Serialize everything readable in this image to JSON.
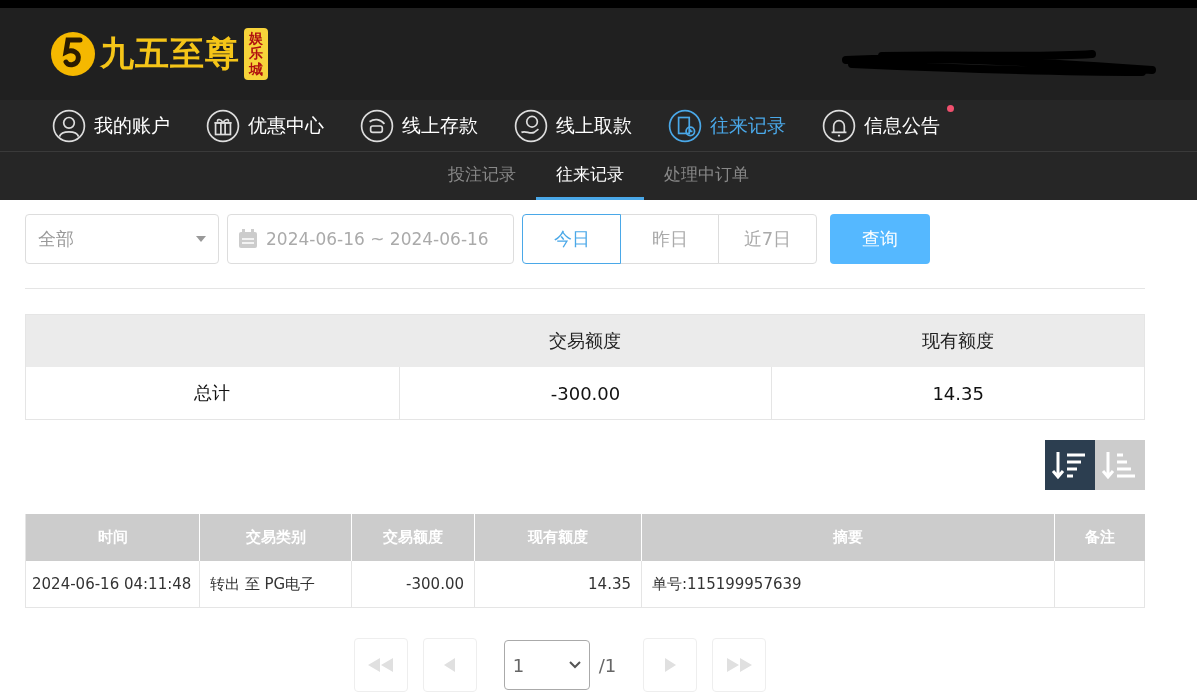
{
  "brand": {
    "name": "九五至尊",
    "badge": "娱乐城"
  },
  "nav": [
    {
      "kind": "account",
      "label": "我的账户",
      "selected": false,
      "dot": false
    },
    {
      "kind": "gift",
      "label": "优惠中心",
      "selected": false,
      "dot": false
    },
    {
      "kind": "deposit",
      "label": "线上存款",
      "selected": false,
      "dot": false
    },
    {
      "kind": "withdraw",
      "label": "线上取款",
      "selected": false,
      "dot": false
    },
    {
      "kind": "records",
      "label": "往来记录",
      "selected": true,
      "dot": false
    },
    {
      "kind": "bell",
      "label": "信息公告",
      "selected": false,
      "dot": true
    }
  ],
  "subtabs": [
    {
      "label": "投注记录",
      "selected": false
    },
    {
      "label": "往来记录",
      "selected": true
    },
    {
      "label": "处理中订单",
      "selected": false
    }
  ],
  "filters": {
    "type_select": {
      "value": "全部"
    },
    "date_range": {
      "value": "2024-06-16 ~ 2024-06-16"
    },
    "quick_ranges": [
      {
        "label": "今日",
        "selected": true
      },
      {
        "label": "昨日",
        "selected": false
      },
      {
        "label": "近7日",
        "selected": false
      }
    ],
    "search_button": "查询"
  },
  "summary": {
    "columns": [
      "交易额度",
      "现有额度"
    ],
    "row": {
      "label": "总计",
      "values": [
        "-300.00",
        "14.35"
      ]
    }
  },
  "sort_buttons": [
    {
      "kind": "desc",
      "selected": true
    },
    {
      "kind": "asc",
      "selected": false
    }
  ],
  "table": {
    "columns": [
      "时间",
      "交易类别",
      "交易额度",
      "现有额度",
      "摘要",
      "备注"
    ],
    "rows": [
      {
        "cells": [
          "2024-06-16 04:11:48",
          "转出 至 PG电子",
          "-300.00",
          "14.35",
          "单号:115199957639",
          ""
        ]
      }
    ]
  },
  "pagination": {
    "page": "1",
    "total": "/1",
    "buttons": [
      {
        "kind": "first",
        "disabled": true
      },
      {
        "kind": "prev",
        "disabled": true
      },
      {
        "kind": "next",
        "disabled": true
      },
      {
        "kind": "last",
        "disabled": true
      }
    ]
  }
}
